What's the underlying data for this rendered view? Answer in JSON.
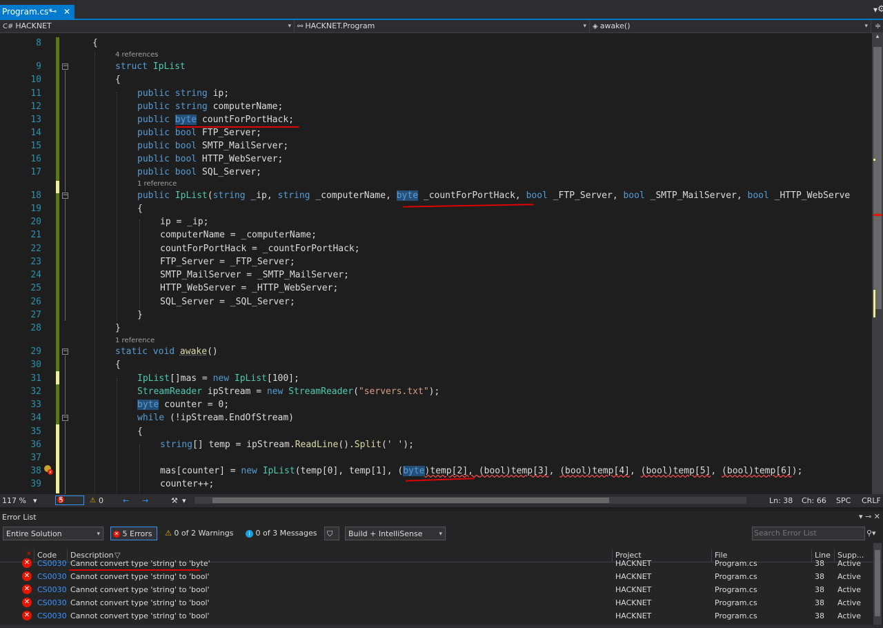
{
  "tab": {
    "title": "Program.cs*",
    "pin_icon": "pin-icon",
    "close": "✕"
  },
  "nav": {
    "project": "HACKNET",
    "class": "HACKNET.Program",
    "member": "awake()"
  },
  "code_lines": [
    {
      "n": "8"
    },
    {
      "n": "9"
    },
    {
      "n": "10"
    },
    {
      "n": "11"
    },
    {
      "n": "12"
    },
    {
      "n": "13"
    },
    {
      "n": "14"
    },
    {
      "n": "15"
    },
    {
      "n": "16"
    },
    {
      "n": "17"
    },
    {
      "n": "18"
    },
    {
      "n": "19"
    },
    {
      "n": "20"
    },
    {
      "n": "21"
    },
    {
      "n": "22"
    },
    {
      "n": "23"
    },
    {
      "n": "24"
    },
    {
      "n": "25"
    },
    {
      "n": "26"
    },
    {
      "n": "27"
    },
    {
      "n": "28"
    },
    {
      "n": "29"
    },
    {
      "n": "30"
    },
    {
      "n": "31"
    },
    {
      "n": "32"
    },
    {
      "n": "33"
    },
    {
      "n": "34"
    },
    {
      "n": "35"
    },
    {
      "n": "36"
    },
    {
      "n": "37"
    },
    {
      "n": "38"
    },
    {
      "n": "39"
    }
  ],
  "code_text": {
    "l8": "{",
    "l9_kw": "struct",
    "l9_ty": "IpList",
    "l10": "{",
    "l11_kw": "public string",
    "l11_rest": " ip;",
    "l12_kw": "public string",
    "l12_rest": " computerName;",
    "l13_kw": "public ",
    "l13_hl": "byte",
    "l13_rest": " countForPortHack;",
    "l14_kw": "public bool",
    "l14_rest": " FTP_Server;",
    "l15_kw": "public bool",
    "l15_rest": " SMTP_MailServer;",
    "l16_kw": "public bool",
    "l16_rest": " HTTP_WebServer;",
    "l17_kw": "public bool",
    "l17_rest": " SQL_Server;",
    "l18_a": "public ",
    "l18_ty": "IpList",
    "l18_b": "(",
    "l18_c": "string",
    " l18_d": " _ip, ",
    "l18_e": "string",
    "l18_f": " _computerName, ",
    "l18_hl": "byte",
    "l18_g": " _countForPortHack, ",
    "l18_h": "bool",
    "l18_i": " _FTP_Server, ",
    "l18_j": "bool",
    "l18_k": " _SMTP_MailServer, ",
    "l18_l": "bool",
    "l18_m": " _HTTP_WebServe",
    "l19": "{",
    "l20": "ip = _ip;",
    "l21": "computerName = _computerName;",
    "l22": "countForPortHack = _countForPortHack;",
    "l23": "FTP_Server = _FTP_Server;",
    "l24": "SMTP_MailServer = _SMTP_MailServer;",
    "l25": "HTTP_WebServer = _HTTP_WebServer;",
    "l26": "SQL_Server = _SQL_Server;",
    "l27": "}",
    "l28": "}",
    "l29_kw": "static void ",
    "l29_mt": "awake",
    "l29_rest": "()",
    "l30": "{",
    "l31_ty": "IpList",
    "l31_rest": "[]mas = ",
    "l31_kw": "new ",
    "l31_ty2": "IpList",
    "l31_rest2": "[100];",
    "l32_ty": "StreamReader",
    "l32_a": " ipStream = ",
    "l32_kw": "new ",
    "l32_ty2": "StreamReader",
    "l32_b": "(",
    "l32_st": "\"servers.txt\"",
    "l32_c": ");",
    "l33_hl": "byte",
    "l33_rest": " counter = 0;",
    "l34_kw": "while",
    "l34_rest": " (!ipStream.EndOfStream)",
    "l35": "{",
    "l36_kw": "string",
    "l36_a": "[] temp = ipStream.",
    "l36_mt": "ReadLine",
    "l36_b": "().",
    "l36_mt2": "Split",
    "l36_c": "(' ');",
    "l38_a": "mas[counter] = ",
    "l38_kw": "new ",
    "l38_ty": "IpList",
    "l38_b": "(temp[0], temp[1], (",
    "l38_hl": "byte",
    "l38_c": ")temp[2], ",
    "l38_d": "(bool)temp[3]",
    ", ": "",
    "l38_e": "(bool)temp[4]",
    "l38_f": "(bool)temp[5]",
    "l38_g": "(bool)temp[6]",
    "l38_end": ");",
    "l39": "counter++;"
  },
  "refs": {
    "r1": "4 references",
    "r2": "1 reference",
    "r3": "1 reference"
  },
  "status": {
    "zoom": "117 %",
    "errors": "5",
    "warnings": "0",
    "ln": "Ln: 38",
    "ch": "Ch: 66",
    "spc": "SPC",
    "crlf": "CRLF"
  },
  "error_panel": {
    "title": "Error List",
    "scope": "Entire Solution",
    "errors_btn": "5 Errors",
    "warnings_btn": "0 of 2 Warnings",
    "messages_btn": "0 of 3 Messages",
    "build": "Build + IntelliSense",
    "search_placeholder": "Search Error List",
    "headers": {
      "code": "Code",
      "desc": "Description",
      "project": "Project",
      "file": "File",
      "line": "Line",
      "supp": "Supp..."
    },
    "rows": [
      {
        "code": "CS0030",
        "desc": "Cannot convert type 'string' to 'byte'",
        "project": "HACKNET",
        "file": "Program.cs",
        "line": "38",
        "supp": "Active"
      },
      {
        "code": "CS0030",
        "desc": "Cannot convert type 'string' to 'bool'",
        "project": "HACKNET",
        "file": "Program.cs",
        "line": "38",
        "supp": "Active"
      },
      {
        "code": "CS0030",
        "desc": "Cannot convert type 'string' to 'bool'",
        "project": "HACKNET",
        "file": "Program.cs",
        "line": "38",
        "supp": "Active"
      },
      {
        "code": "CS0030",
        "desc": "Cannot convert type 'string' to 'bool'",
        "project": "HACKNET",
        "file": "Program.cs",
        "line": "38",
        "supp": "Active"
      },
      {
        "code": "CS0030",
        "desc": "Cannot convert type 'string' to 'bool'",
        "project": "HACKNET",
        "file": "Program.cs",
        "line": "38",
        "supp": "Active"
      }
    ]
  },
  "colors": {
    "accent": "#007acc",
    "keyword": "#569cd6",
    "type": "#4ec9b0",
    "string": "#d69d85",
    "error": "#e51400",
    "annotation": "#e00000"
  }
}
